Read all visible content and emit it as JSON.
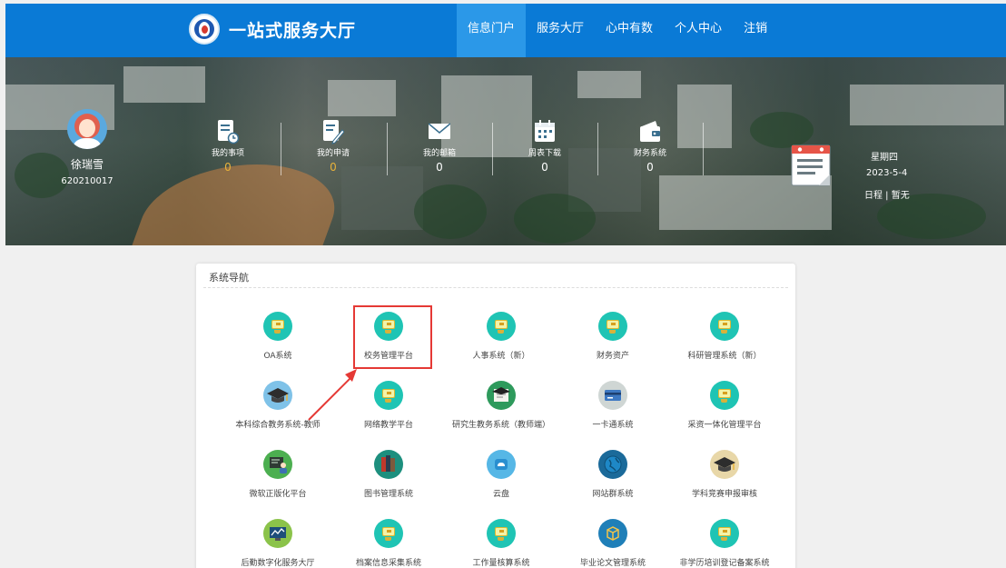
{
  "header": {
    "site_title": "一站式服务大厅",
    "nav": [
      {
        "label": "信息门户",
        "active": true
      },
      {
        "label": "服务大厅",
        "active": false
      },
      {
        "label": "心中有数",
        "active": false
      },
      {
        "label": "个人中心",
        "active": false
      },
      {
        "label": "注销",
        "active": false
      }
    ]
  },
  "user": {
    "name": "徐瑞雪",
    "id": "620210017"
  },
  "stats": [
    {
      "label": "我的事项",
      "count": "0",
      "icon": "todo-icon",
      "count_color": "#e8b23a"
    },
    {
      "label": "我的申请",
      "count": "0",
      "icon": "apply-icon",
      "count_color": "#e8b23a"
    },
    {
      "label": "我的邮箱",
      "count": "0",
      "icon": "mail-icon",
      "count_color": "#ffffff"
    },
    {
      "label": "周表下载",
      "count": "0",
      "icon": "calendar-icon",
      "count_color": "#ffffff"
    },
    {
      "label": "财务系统",
      "count": "0",
      "icon": "wallet-icon",
      "count_color": "#ffffff"
    }
  ],
  "schedule": {
    "weekday": "星期四",
    "date": "2023-5-4",
    "text": "日程 | 暂无"
  },
  "panel": {
    "title": "系统导航",
    "systems": [
      {
        "name": "OA系统",
        "icon": "app-icon"
      },
      {
        "name": "校务管理平台",
        "icon": "app-icon"
      },
      {
        "name": "人事系统（新）",
        "icon": "app-icon"
      },
      {
        "name": "财务资产",
        "icon": "app-icon"
      },
      {
        "name": "科研管理系统（新）",
        "icon": "app-icon"
      },
      {
        "name": "本科综合教务系统-教师",
        "icon": "graduation-cap-icon"
      },
      {
        "name": "网络教学平台",
        "icon": "app-icon"
      },
      {
        "name": "研究生教务系统（教师端）",
        "icon": "certificate-icon"
      },
      {
        "name": "一卡通系统",
        "icon": "card-icon"
      },
      {
        "name": "采资一体化管理平台",
        "icon": "app-icon"
      },
      {
        "name": "微软正版化平台",
        "icon": "teacher-icon"
      },
      {
        "name": "图书管理系统",
        "icon": "books-icon"
      },
      {
        "name": "云盘",
        "icon": "cloud-icon"
      },
      {
        "name": "网站群系统",
        "icon": "globe-icon"
      },
      {
        "name": "学科竞赛申报审核",
        "icon": "graduation-cap-icon"
      },
      {
        "name": "后勤数字化服务大厅",
        "icon": "monitor-chart-icon"
      },
      {
        "name": "档案信息采集系统",
        "icon": "app-icon"
      },
      {
        "name": "工作量核算系统",
        "icon": "app-icon"
      },
      {
        "name": "毕业论文管理系统",
        "icon": "cube-icon"
      },
      {
        "name": "非学历培训登记备案系统",
        "icon": "app-icon"
      }
    ]
  },
  "colors": {
    "header": "#0a7ad6",
    "nav_active": "#2b98e8",
    "accent_teal": "#1fc4b4",
    "highlight": "#e53935"
  }
}
